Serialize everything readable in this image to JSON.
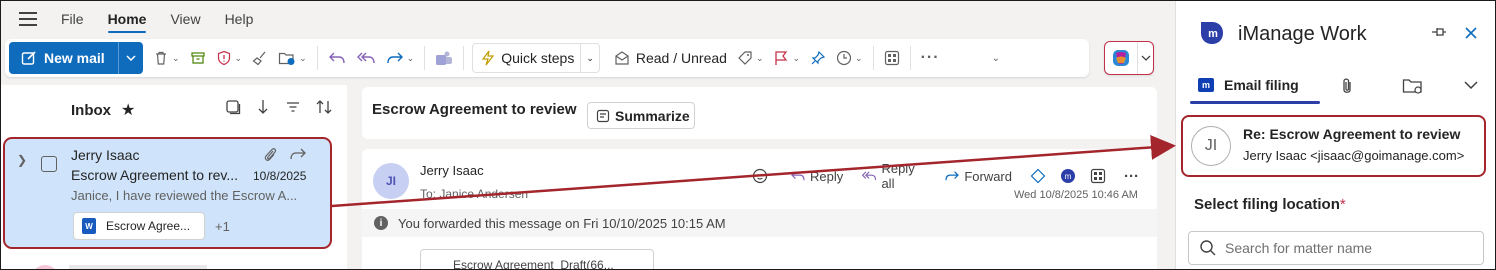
{
  "menubar": {
    "items": [
      "File",
      "Home",
      "View",
      "Help"
    ],
    "active": "Home"
  },
  "ribbon": {
    "new_mail": "New mail",
    "quick_steps": "Quick steps",
    "read_unread": "Read / Unread"
  },
  "inbox": {
    "title": "Inbox",
    "item": {
      "sender": "Jerry Isaac",
      "subject": "Escrow Agreement to rev...",
      "date": "10/8/2025",
      "preview": "Janice, I have reviewed the Escrow A...",
      "attachment": "Escrow Agree...",
      "more_attachments": "+1"
    }
  },
  "reading": {
    "subject": "Escrow Agreement to review",
    "summarize": "Summarize",
    "avatar_initials": "JI",
    "sender": "Jerry Isaac",
    "to": "To: Janice Andersen",
    "reply": "Reply",
    "reply_all": "Reply all",
    "forward": "Forward",
    "date": "Wed 10/8/2025 10:46 AM",
    "forwarded_notice": "You forwarded this message on Fri 10/10/2025 10:15 AM",
    "attachment": "Escrow Agreement_Draft(66..."
  },
  "imanage": {
    "title": "iManage Work",
    "tab_email_filing": "Email filing",
    "card": {
      "initials": "JI",
      "subject": "Re: Escrow Agreement to review",
      "from": "Jerry Isaac <jisaac@goimanage.com>"
    },
    "filing_label": "Select filing location",
    "required_mark": "*",
    "search_placeholder": "Search for matter name"
  },
  "colors": {
    "accent": "#0f6cbd",
    "selection": "#cfe4fa",
    "highlight_border": "#a4262c",
    "imanage_brand": "#2c3fa8"
  }
}
